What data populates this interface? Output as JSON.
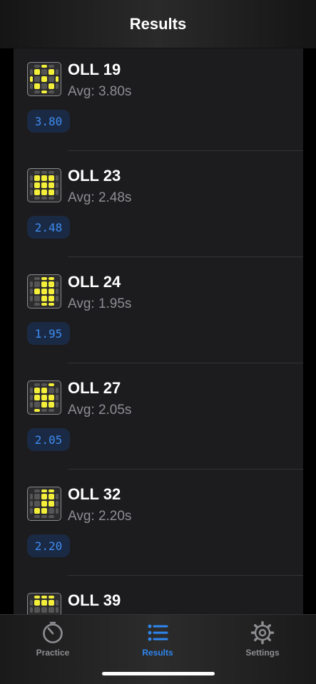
{
  "header": {
    "title": "Results"
  },
  "results": [
    {
      "name": "OLL 19",
      "avg": "Avg: 3.80s",
      "time": "3.80",
      "pattern": [
        [
          0,
          0,
          1,
          0,
          0
        ],
        [
          0,
          1,
          0,
          1,
          0
        ],
        [
          1,
          0,
          1,
          0,
          1
        ],
        [
          0,
          1,
          0,
          1,
          0
        ],
        [
          0,
          0,
          1,
          0,
          0
        ]
      ]
    },
    {
      "name": "OLL 23",
      "avg": "Avg: 2.48s",
      "time": "2.48",
      "pattern": [
        [
          0,
          0,
          0,
          0,
          0
        ],
        [
          0,
          1,
          1,
          1,
          0
        ],
        [
          0,
          1,
          1,
          1,
          0
        ],
        [
          0,
          1,
          1,
          1,
          0
        ],
        [
          0,
          0,
          0,
          0,
          0
        ]
      ]
    },
    {
      "name": "OLL 24",
      "avg": "Avg: 1.95s",
      "time": "1.95",
      "pattern": [
        [
          0,
          0,
          1,
          1,
          0
        ],
        [
          0,
          0,
          1,
          1,
          0
        ],
        [
          0,
          1,
          1,
          1,
          0
        ],
        [
          0,
          0,
          1,
          1,
          0
        ],
        [
          0,
          0,
          1,
          1,
          0
        ]
      ]
    },
    {
      "name": "OLL 27",
      "avg": "Avg: 2.05s",
      "time": "2.05",
      "pattern": [
        [
          0,
          0,
          0,
          1,
          0
        ],
        [
          0,
          1,
          1,
          0,
          0
        ],
        [
          0,
          1,
          1,
          1,
          0
        ],
        [
          0,
          0,
          1,
          1,
          0
        ],
        [
          0,
          1,
          0,
          0,
          0
        ]
      ]
    },
    {
      "name": "OLL 32",
      "avg": "Avg: 2.20s",
      "time": "2.20",
      "pattern": [
        [
          0,
          0,
          1,
          1,
          0
        ],
        [
          0,
          0,
          1,
          1,
          0
        ],
        [
          0,
          0,
          1,
          1,
          0
        ],
        [
          0,
          1,
          1,
          0,
          0
        ],
        [
          0,
          0,
          0,
          0,
          0
        ]
      ]
    },
    {
      "name": "OLL 39",
      "avg": "",
      "time": "",
      "pattern": [
        [
          0,
          1,
          1,
          1,
          0
        ],
        [
          0,
          1,
          1,
          1,
          0
        ],
        [
          0,
          0,
          0,
          0,
          0
        ],
        [
          0,
          0,
          0,
          0,
          0
        ],
        [
          0,
          0,
          0,
          0,
          0
        ]
      ]
    }
  ],
  "tabs": [
    {
      "label": "Practice",
      "icon": "timer-icon",
      "active": false
    },
    {
      "label": "Results",
      "icon": "list-icon",
      "active": true
    },
    {
      "label": "Settings",
      "icon": "gear-icon",
      "active": false
    }
  ],
  "colors": {
    "accent": "#2f86f0",
    "sticker_yellow": "#f4f03a",
    "sticker_gray": "#555555"
  }
}
